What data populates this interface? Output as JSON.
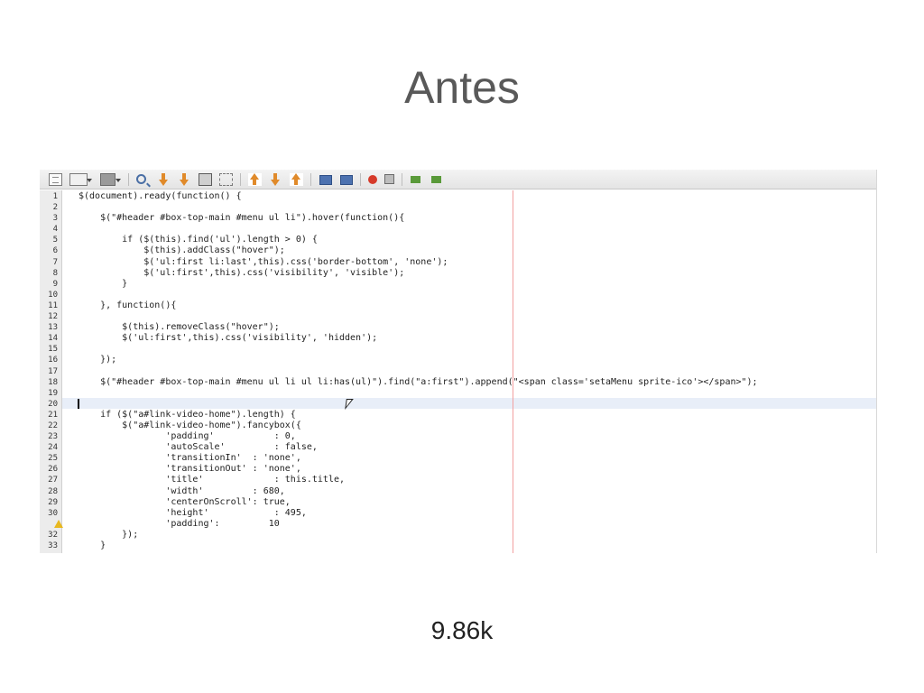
{
  "slide": {
    "title": "Antes",
    "caption": "9.86k"
  },
  "toolbar": {
    "buttons": [
      "new-file-icon",
      "open-dropdown-icon",
      "save-dropdown-icon",
      "find-icon",
      "find-prev-icon",
      "find-next-icon",
      "toggle-highlight-icon",
      "toggle-rect-select-icon",
      "prev-bookmark-icon",
      "next-bookmark-icon",
      "toggle-bookmark-icon",
      "shift-left-icon",
      "shift-right-icon",
      "start-macro-icon",
      "stop-macro-icon",
      "run-icon",
      "debug-icon"
    ]
  },
  "editor": {
    "current_line": 20,
    "warning_line": 31,
    "lines": [
      {
        "n": "1",
        "t": "$(document).ready(function() {"
      },
      {
        "n": "2",
        "t": ""
      },
      {
        "n": "3",
        "t": "    $(\"#header #box-top-main #menu ul li\").hover(function(){"
      },
      {
        "n": "4",
        "t": ""
      },
      {
        "n": "5",
        "t": "        if ($(this).find('ul').length > 0) {"
      },
      {
        "n": "6",
        "t": "            $(this).addClass(\"hover\");"
      },
      {
        "n": "7",
        "t": "            $('ul:first li:last',this).css('border-bottom', 'none');"
      },
      {
        "n": "8",
        "t": "            $('ul:first',this).css('visibility', 'visible');"
      },
      {
        "n": "9",
        "t": "        }"
      },
      {
        "n": "10",
        "t": ""
      },
      {
        "n": "11",
        "t": "    }, function(){"
      },
      {
        "n": "12",
        "t": ""
      },
      {
        "n": "13",
        "t": "        $(this).removeClass(\"hover\");"
      },
      {
        "n": "14",
        "t": "        $('ul:first',this).css('visibility', 'hidden');"
      },
      {
        "n": "15",
        "t": ""
      },
      {
        "n": "16",
        "t": "    });"
      },
      {
        "n": "17",
        "t": ""
      },
      {
        "n": "18",
        "t": "    $(\"#header #box-top-main #menu ul li ul li:has(ul)\").find(\"a:first\").append(\"<span class='setaMenu sprite-ico'></span>\");"
      },
      {
        "n": "19",
        "t": ""
      },
      {
        "n": "20",
        "t": ""
      },
      {
        "n": "21",
        "t": "    if ($(\"a#link-video-home\").length) {"
      },
      {
        "n": "22",
        "t": "        $(\"a#link-video-home\").fancybox({"
      },
      {
        "n": "23",
        "t": "                'padding'           : 0,"
      },
      {
        "n": "24",
        "t": "                'autoScale'         : false,"
      },
      {
        "n": "25",
        "t": "                'transitionIn'  : 'none',"
      },
      {
        "n": "26",
        "t": "                'transitionOut' : 'none',"
      },
      {
        "n": "27",
        "t": "                'title'             : this.title,"
      },
      {
        "n": "28",
        "t": "                'width'         : 680,"
      },
      {
        "n": "29",
        "t": "                'centerOnScroll': true,"
      },
      {
        "n": "30",
        "t": "                'height'            : 495,"
      },
      {
        "n": "",
        "t": "                'padding':         10"
      },
      {
        "n": "32",
        "t": "        });"
      },
      {
        "n": "33",
        "t": "    }"
      }
    ]
  }
}
